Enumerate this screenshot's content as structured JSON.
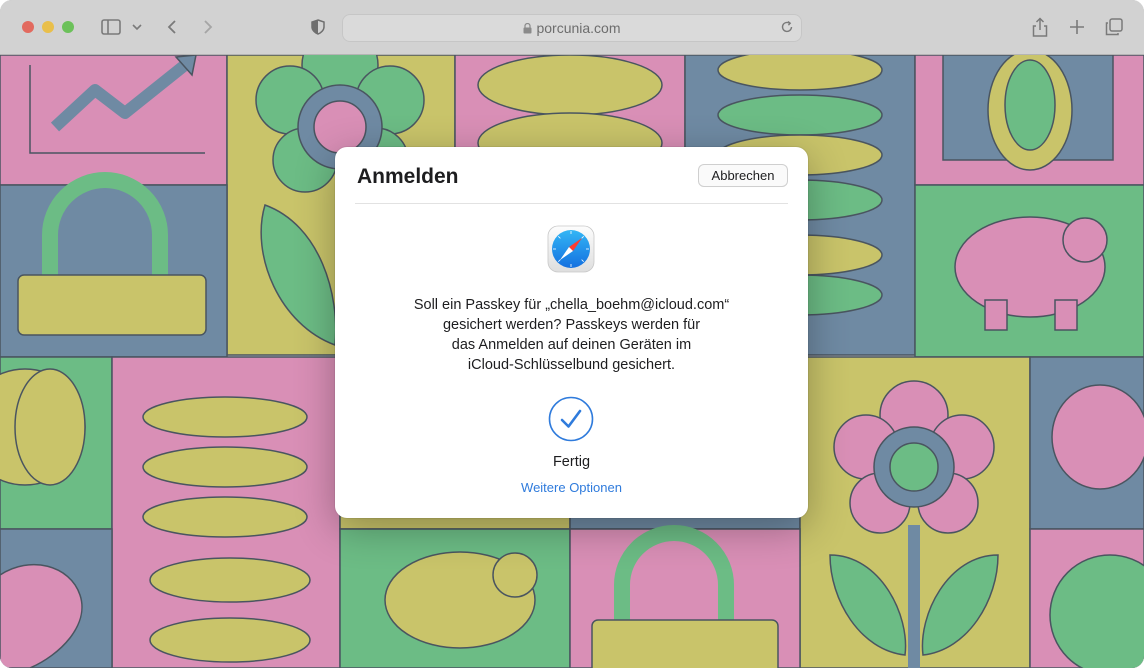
{
  "browser": {
    "url": "porcunia.com",
    "icons": [
      "sidebar-icon",
      "chevron-down-icon",
      "back-icon",
      "forward-icon",
      "privacy-shield-icon",
      "lock-icon",
      "reload-icon",
      "share-icon",
      "new-tab-icon",
      "tab-overview-icon"
    ]
  },
  "dialog": {
    "title": "Anmelden",
    "cancel_label": "Abbrechen",
    "message_lines": [
      "Soll ein Passkey für „chella_boehm@icloud.com“",
      "gesichert werden? Passkeys werden für",
      "das Anmelden auf deinen Geräten im",
      "iCloud-Schlüsselbund gesichert."
    ],
    "status_label": "Fertig",
    "more_options_label": "Weitere Optionen"
  },
  "colors": {
    "pink": "#d98fb6",
    "yellow": "#c9c46a",
    "green": "#6cbc85",
    "blue": "#6f8aa3",
    "accent": "#2f7bdc"
  }
}
